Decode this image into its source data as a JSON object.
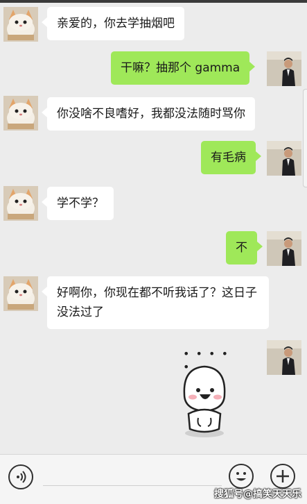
{
  "messages": [
    {
      "side": "in",
      "text": "亲爱的，你去学抽烟吧"
    },
    {
      "side": "out",
      "text": "干嘛？抽那个 gamma"
    },
    {
      "side": "in",
      "text": "你没啥不良嗜好，我都没法随时骂你"
    },
    {
      "side": "out",
      "text": "有毛病"
    },
    {
      "side": "in",
      "text": "学不学？"
    },
    {
      "side": "out",
      "text": "不"
    },
    {
      "side": "in",
      "text": "好啊你，你现在都不听我话了？这日子没法过了"
    }
  ],
  "sticker": {
    "icon": "smiling-dumpling-sticker",
    "caption": "• • • • •"
  },
  "input_bar": {
    "voice_icon": "voice-icon",
    "emoji_icon": "emoji-icon",
    "add_icon": "plus-icon"
  },
  "watermark": "搜狐号@搞笑天天乐",
  "colors": {
    "background": "#ececec",
    "outgoing": "#9fe859",
    "incoming": "#ffffff"
  }
}
